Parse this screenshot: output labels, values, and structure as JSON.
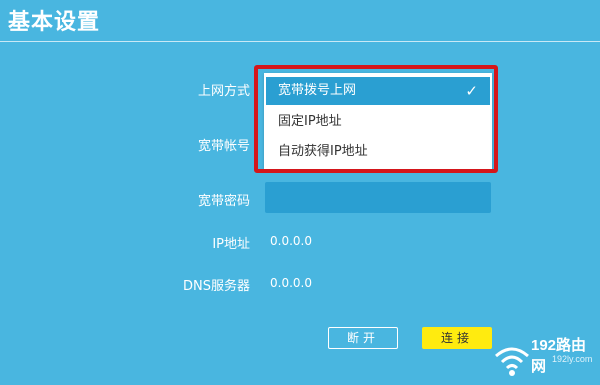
{
  "page": {
    "title": "基本设置"
  },
  "form": {
    "labels": {
      "connection_type": "上网方式",
      "account": "宽带帐号",
      "password": "宽带密码",
      "ip": "IP地址",
      "dns": "DNS服务器"
    },
    "values": {
      "ip": "0.0.0.0",
      "dns": "0.0.0.0"
    }
  },
  "dropdown": {
    "selected": "宽带拨号上网",
    "options": [
      "宽带拨号上网",
      "固定IP地址",
      "自动获得IP地址"
    ],
    "check_icon": "✓"
  },
  "buttons": {
    "disconnect": "断开",
    "connect": "连接"
  },
  "watermark": {
    "text": "192路由网",
    "sub": "192ly.com"
  },
  "colors": {
    "background": "#49b6e0",
    "selected": "#2a9fd2",
    "connect_button": "#ffeb0f",
    "highlight_frame": "#d4161b"
  }
}
